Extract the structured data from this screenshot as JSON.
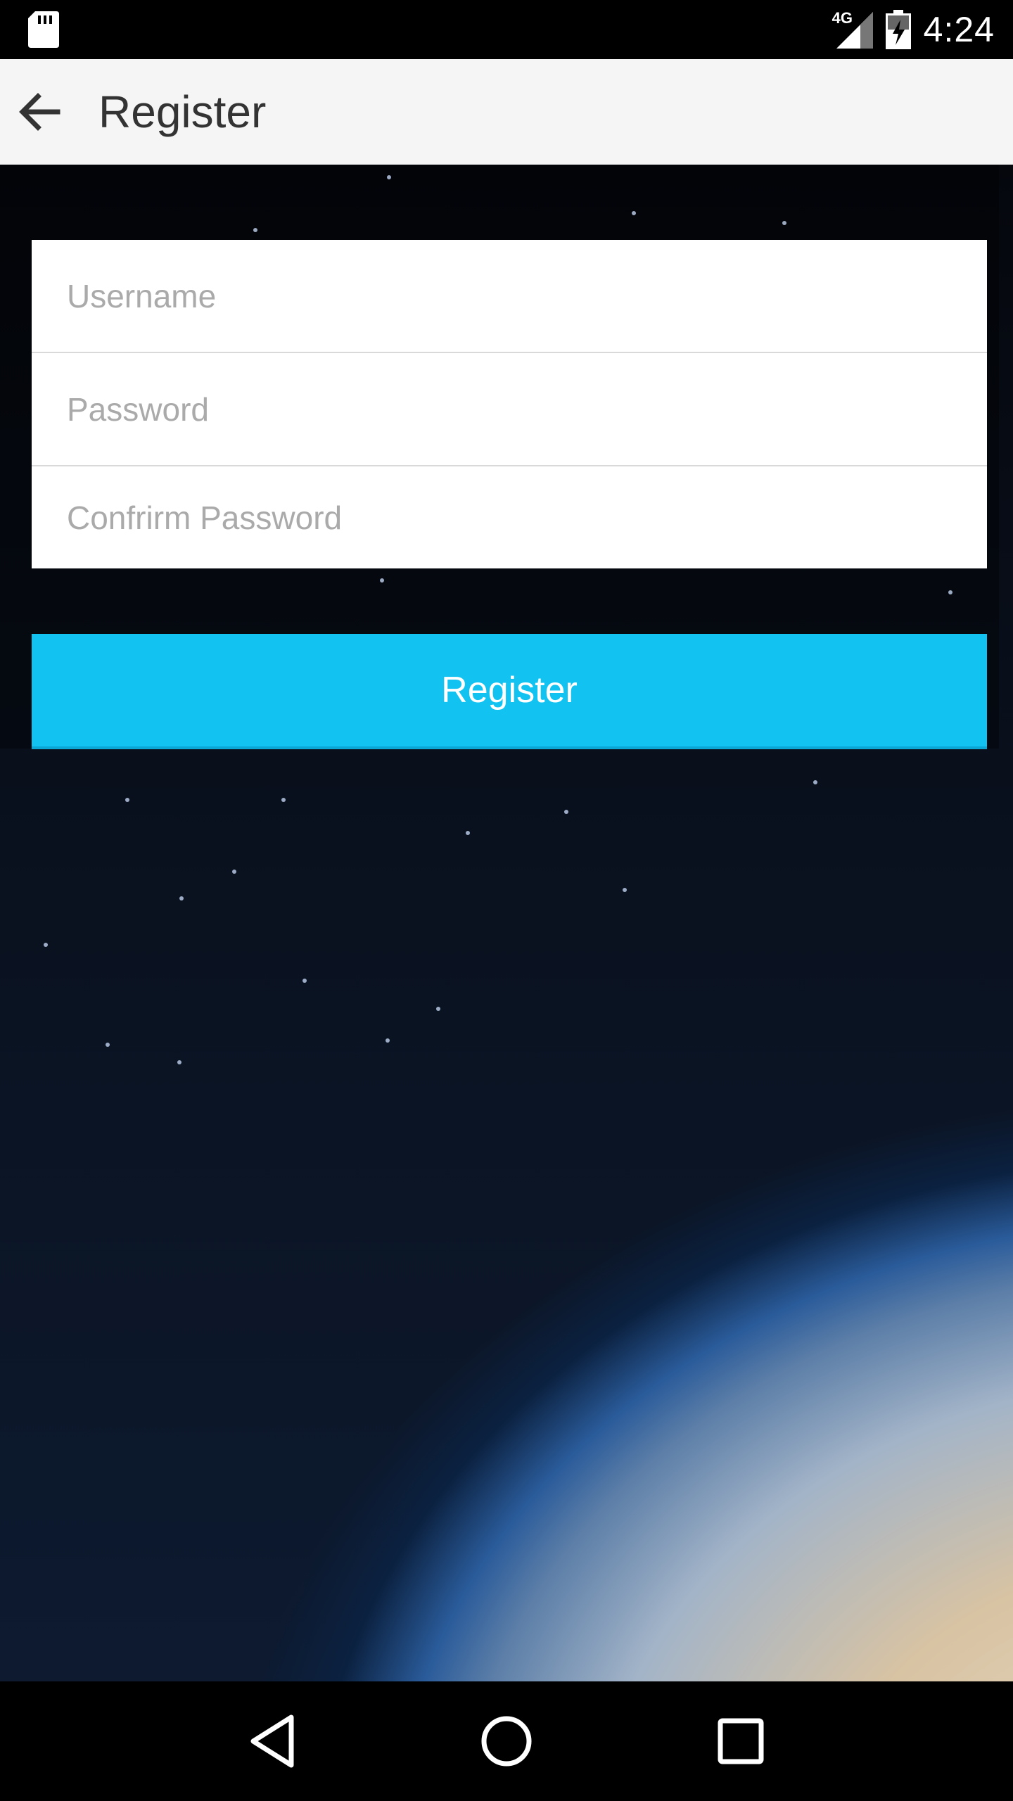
{
  "status_bar": {
    "network": "4G",
    "time": "4:24",
    "icons": [
      "sd-card-icon",
      "signal-icon",
      "battery-charging-icon"
    ]
  },
  "app_bar": {
    "back_icon": "arrow-back-icon",
    "title": "Register"
  },
  "form": {
    "username": {
      "placeholder": "Username",
      "value": ""
    },
    "password": {
      "placeholder": "Password",
      "value": ""
    },
    "confirm_password": {
      "placeholder": "Confrirm Password",
      "value": ""
    }
  },
  "register_button": {
    "label": "Register"
  },
  "colors": {
    "accent": "#12c2f0",
    "app_bar_bg": "#f5f5f5",
    "status_bar_bg": "#000000"
  },
  "nav_bar": {
    "icons": [
      "back-triangle-icon",
      "home-circle-icon",
      "recents-square-icon"
    ]
  }
}
